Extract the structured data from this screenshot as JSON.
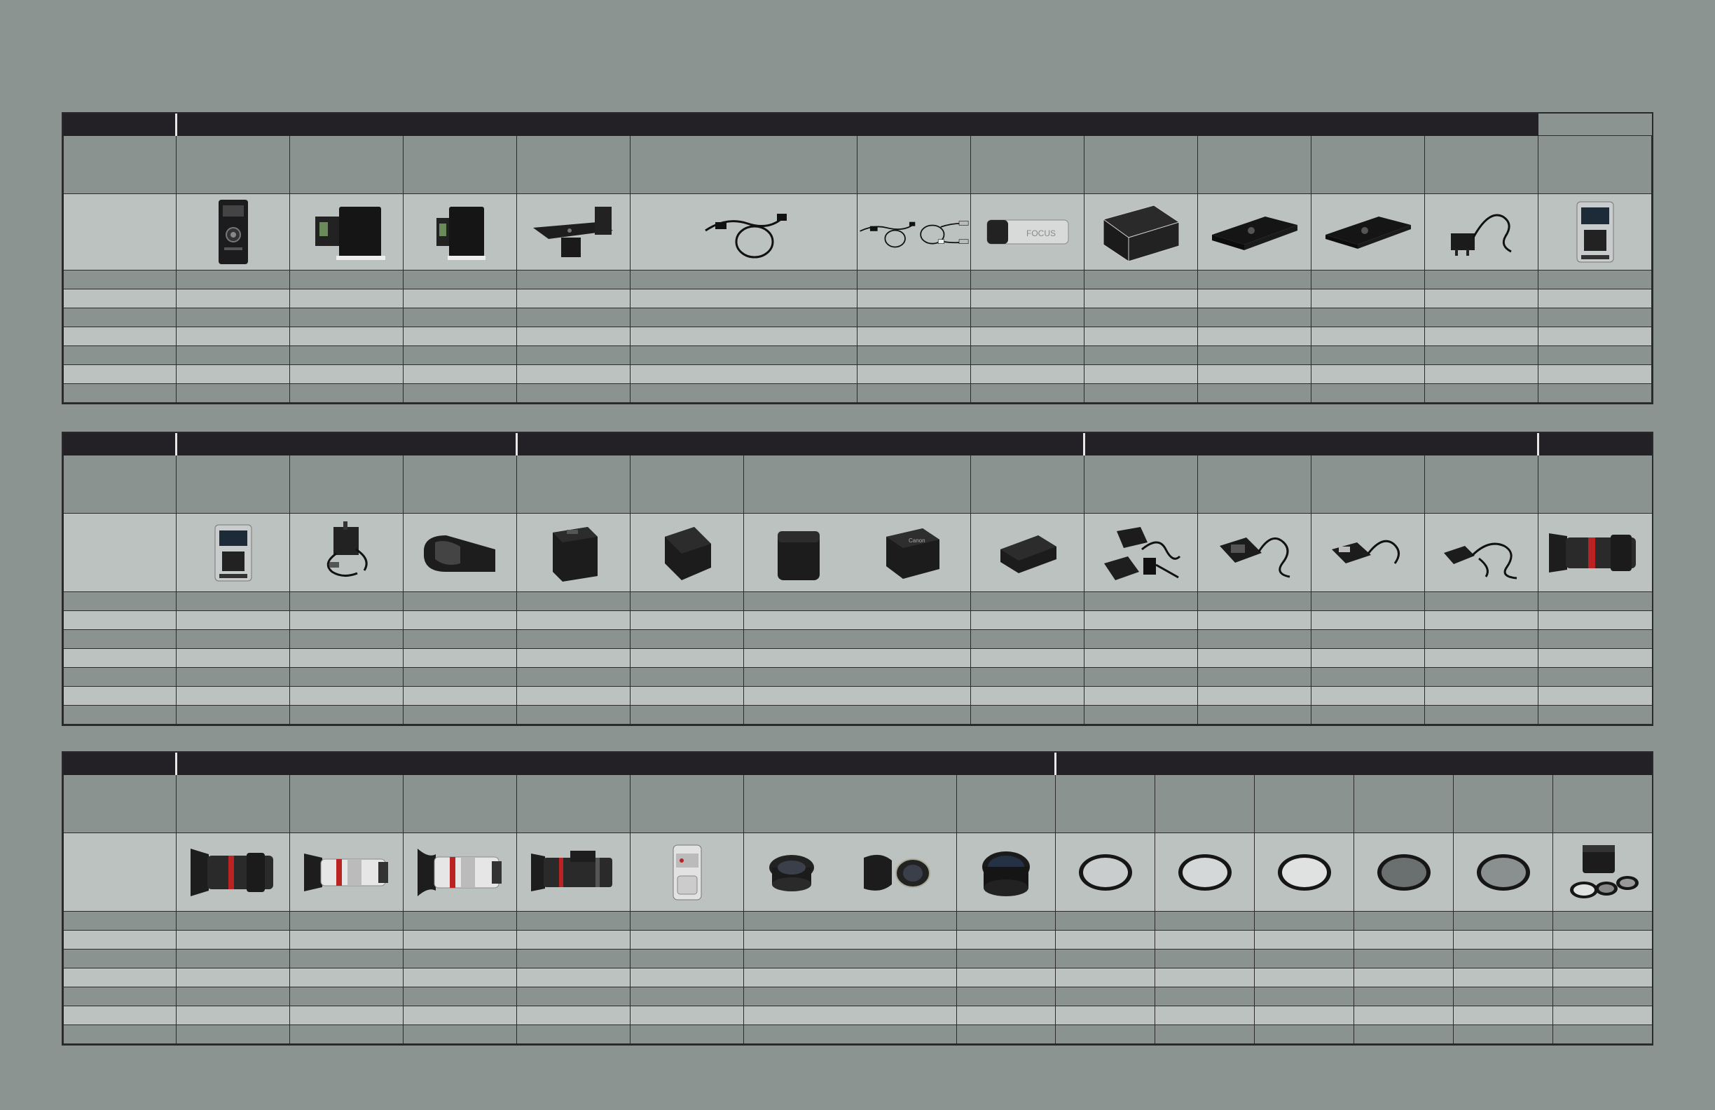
{
  "sections": [
    {
      "name": "accessories-table-1",
      "group_headers": [
        "",
        ""
      ],
      "product_columns": 13,
      "photos": [
        "recorder-unit",
        "battery-adapter",
        "battery-adapter-small",
        "mount-bracket",
        "dc-cable",
        "dc-cable-coupler",
        "usb-cable",
        "dongle-card",
        "case-adapter",
        "hard-case",
        "hard-case-slim",
        "ac-adapter-cord",
        "display-unit"
      ]
    },
    {
      "name": "accessories-table-2",
      "group_headers": [
        "",
        "",
        "",
        ""
      ],
      "product_columns": 13,
      "photos": [
        "display-unit",
        "wireless-receiver",
        "battery-grip",
        "battery-large",
        "battery-medium",
        "battery-xl",
        "battery-tall",
        "battery-slim",
        "charger-kit",
        "charger",
        "charger-compact",
        "charger-dual",
        "zoom-lens"
      ]
    },
    {
      "name": "lenses-filters-table",
      "group_headers": [
        "",
        ""
      ],
      "product_columns": 14,
      "photos": [
        "zoom-lens-hooded",
        "zoom-lens-white",
        "zoom-lens-white-hood",
        "servo-lens",
        "lens-adapter",
        "wide-converter",
        "converter-with-hood",
        "tele-converter",
        "uv-filter",
        "protect-filter",
        "clear-filter",
        "nd-filter",
        "pl-filter",
        "filter-kit"
      ]
    }
  ]
}
